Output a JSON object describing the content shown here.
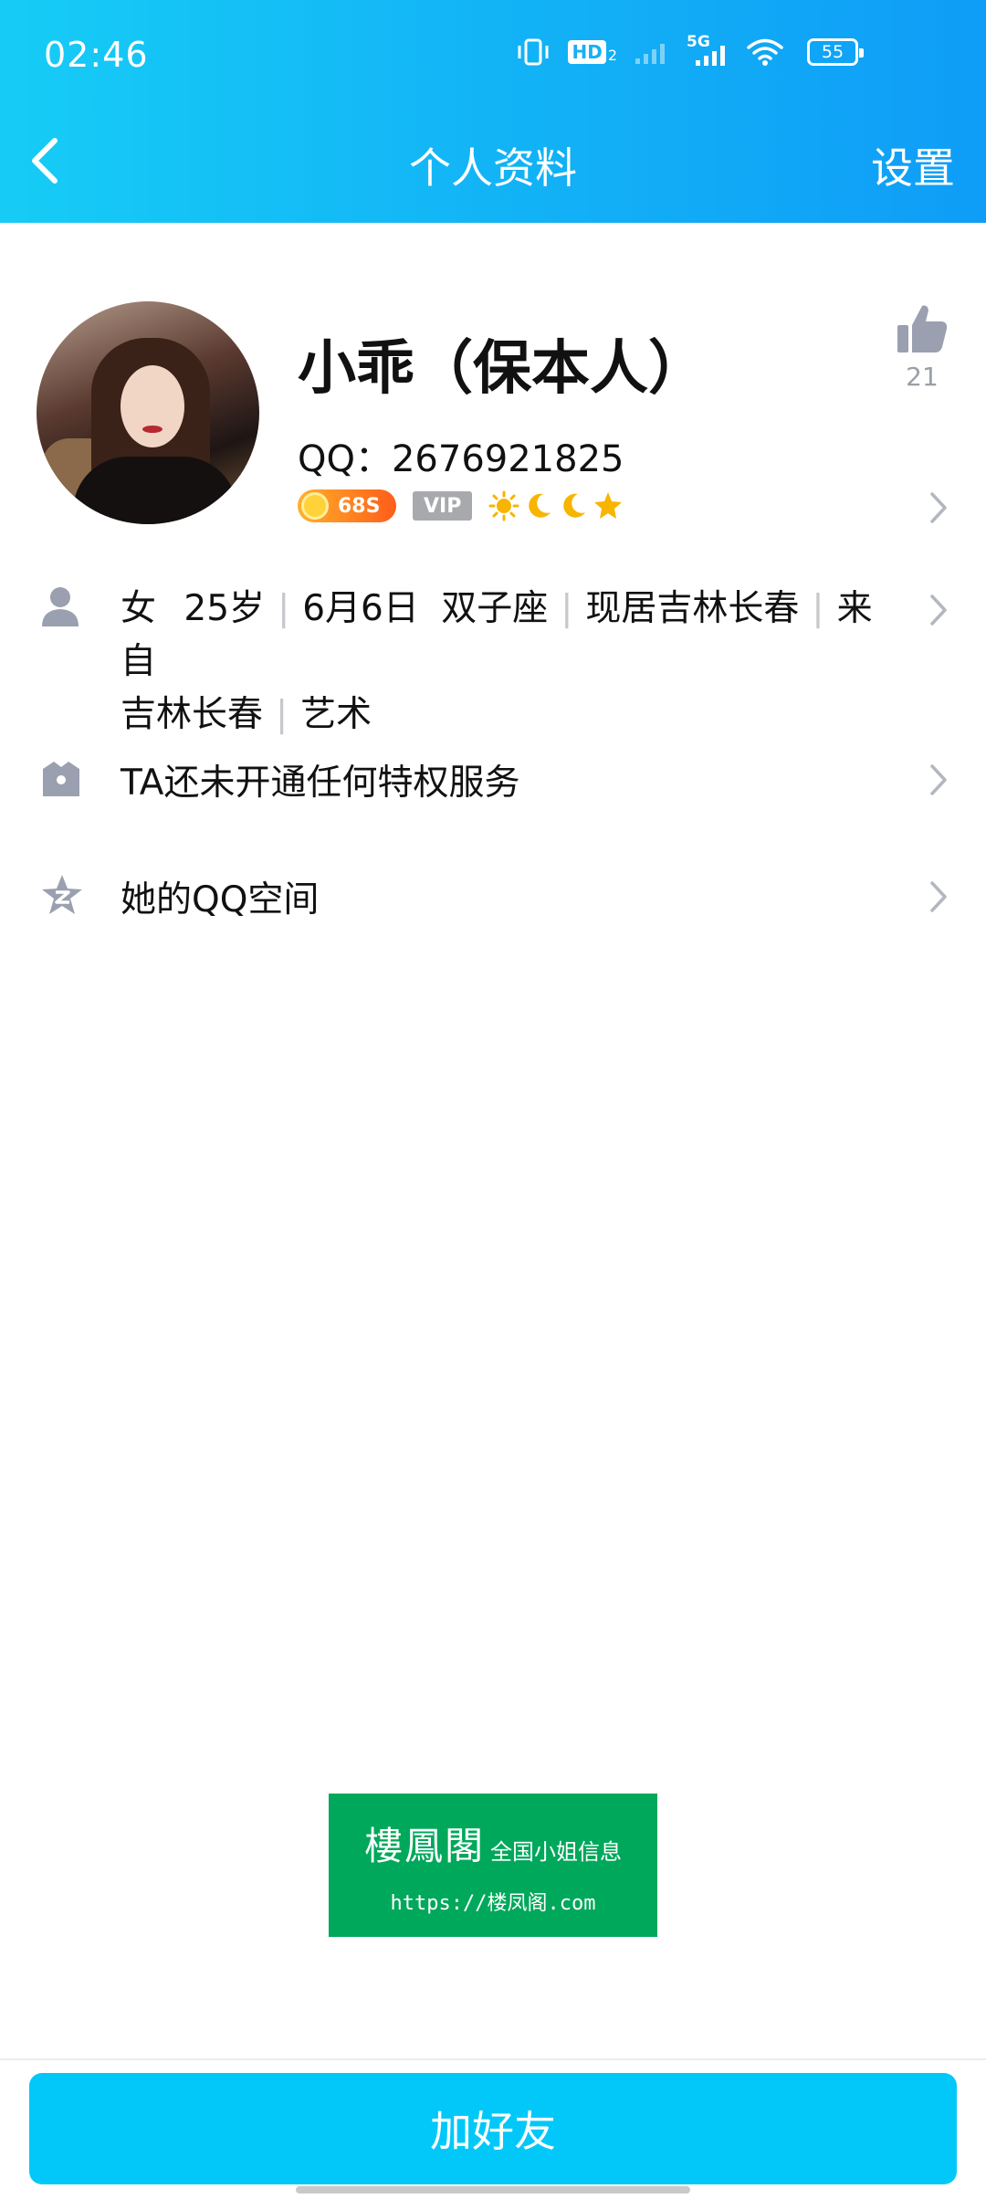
{
  "status_bar": {
    "time": "02:46",
    "hd_label": "HD",
    "network_label": "5G",
    "battery": "55"
  },
  "nav": {
    "title": "个人资料",
    "right_action": "设置"
  },
  "profile": {
    "name": "小乖（保本人）",
    "qq_label": "QQ：",
    "qq_number": "2676921825",
    "coin_badge": "68S",
    "vip_badge": "VIP",
    "likes": "21"
  },
  "details": {
    "gender": "女",
    "age": "25岁",
    "birthday": "6月6日",
    "zodiac": "双子座",
    "location": "现居吉林长春",
    "hometown_prefix": "来自",
    "hometown": "吉林长春",
    "occupation": "艺术"
  },
  "rows": {
    "privilege": "TA还未开通任何特权服务",
    "qzone": "她的QQ空间"
  },
  "watermark": {
    "brand": "樓鳳閣",
    "tagline": "全国小姐信息",
    "url": "https://楼凤阁.com"
  },
  "bottom": {
    "add_friend": "加好友"
  },
  "colors": {
    "header_start": "#16ccf6",
    "header_end": "#0f9df7",
    "button": "#02c8f9",
    "icon_gray": "#9aa0b0"
  }
}
